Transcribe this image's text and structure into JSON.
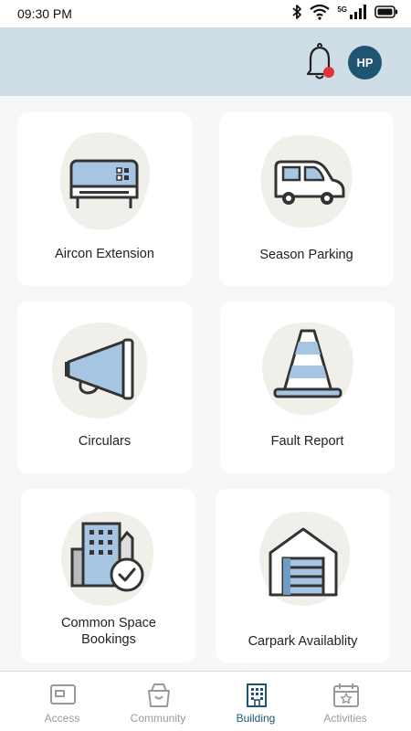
{
  "status_bar": {
    "time": "09:30 PM",
    "network": "5G"
  },
  "header": {
    "avatar_initials": "HP",
    "notification_dot_color": "#e03535"
  },
  "colors": {
    "accent": "#1f5572",
    "header_bg": "#cfdde6",
    "icon_fill": "#a5c5e3",
    "blob": "#f1efe9"
  },
  "tiles": [
    {
      "label": "Aircon Extension",
      "icon": "aircon-icon"
    },
    {
      "label": "Season Parking",
      "icon": "car-icon"
    },
    {
      "label": "Circulars",
      "icon": "megaphone-icon"
    },
    {
      "label": "Fault Report",
      "icon": "traffic-cone-icon"
    },
    {
      "label": "Common Space Bookings",
      "icon": "building-check-icon"
    },
    {
      "label": "Carpark Availablity",
      "icon": "garage-icon"
    }
  ],
  "tabs": [
    {
      "label": "Access",
      "icon": "access-card-icon",
      "active": false
    },
    {
      "label": "Community",
      "icon": "shopping-bag-icon",
      "active": false
    },
    {
      "label": "Building",
      "icon": "building-icon",
      "active": true
    },
    {
      "label": "Activities",
      "icon": "calendar-star-icon",
      "active": false
    }
  ]
}
